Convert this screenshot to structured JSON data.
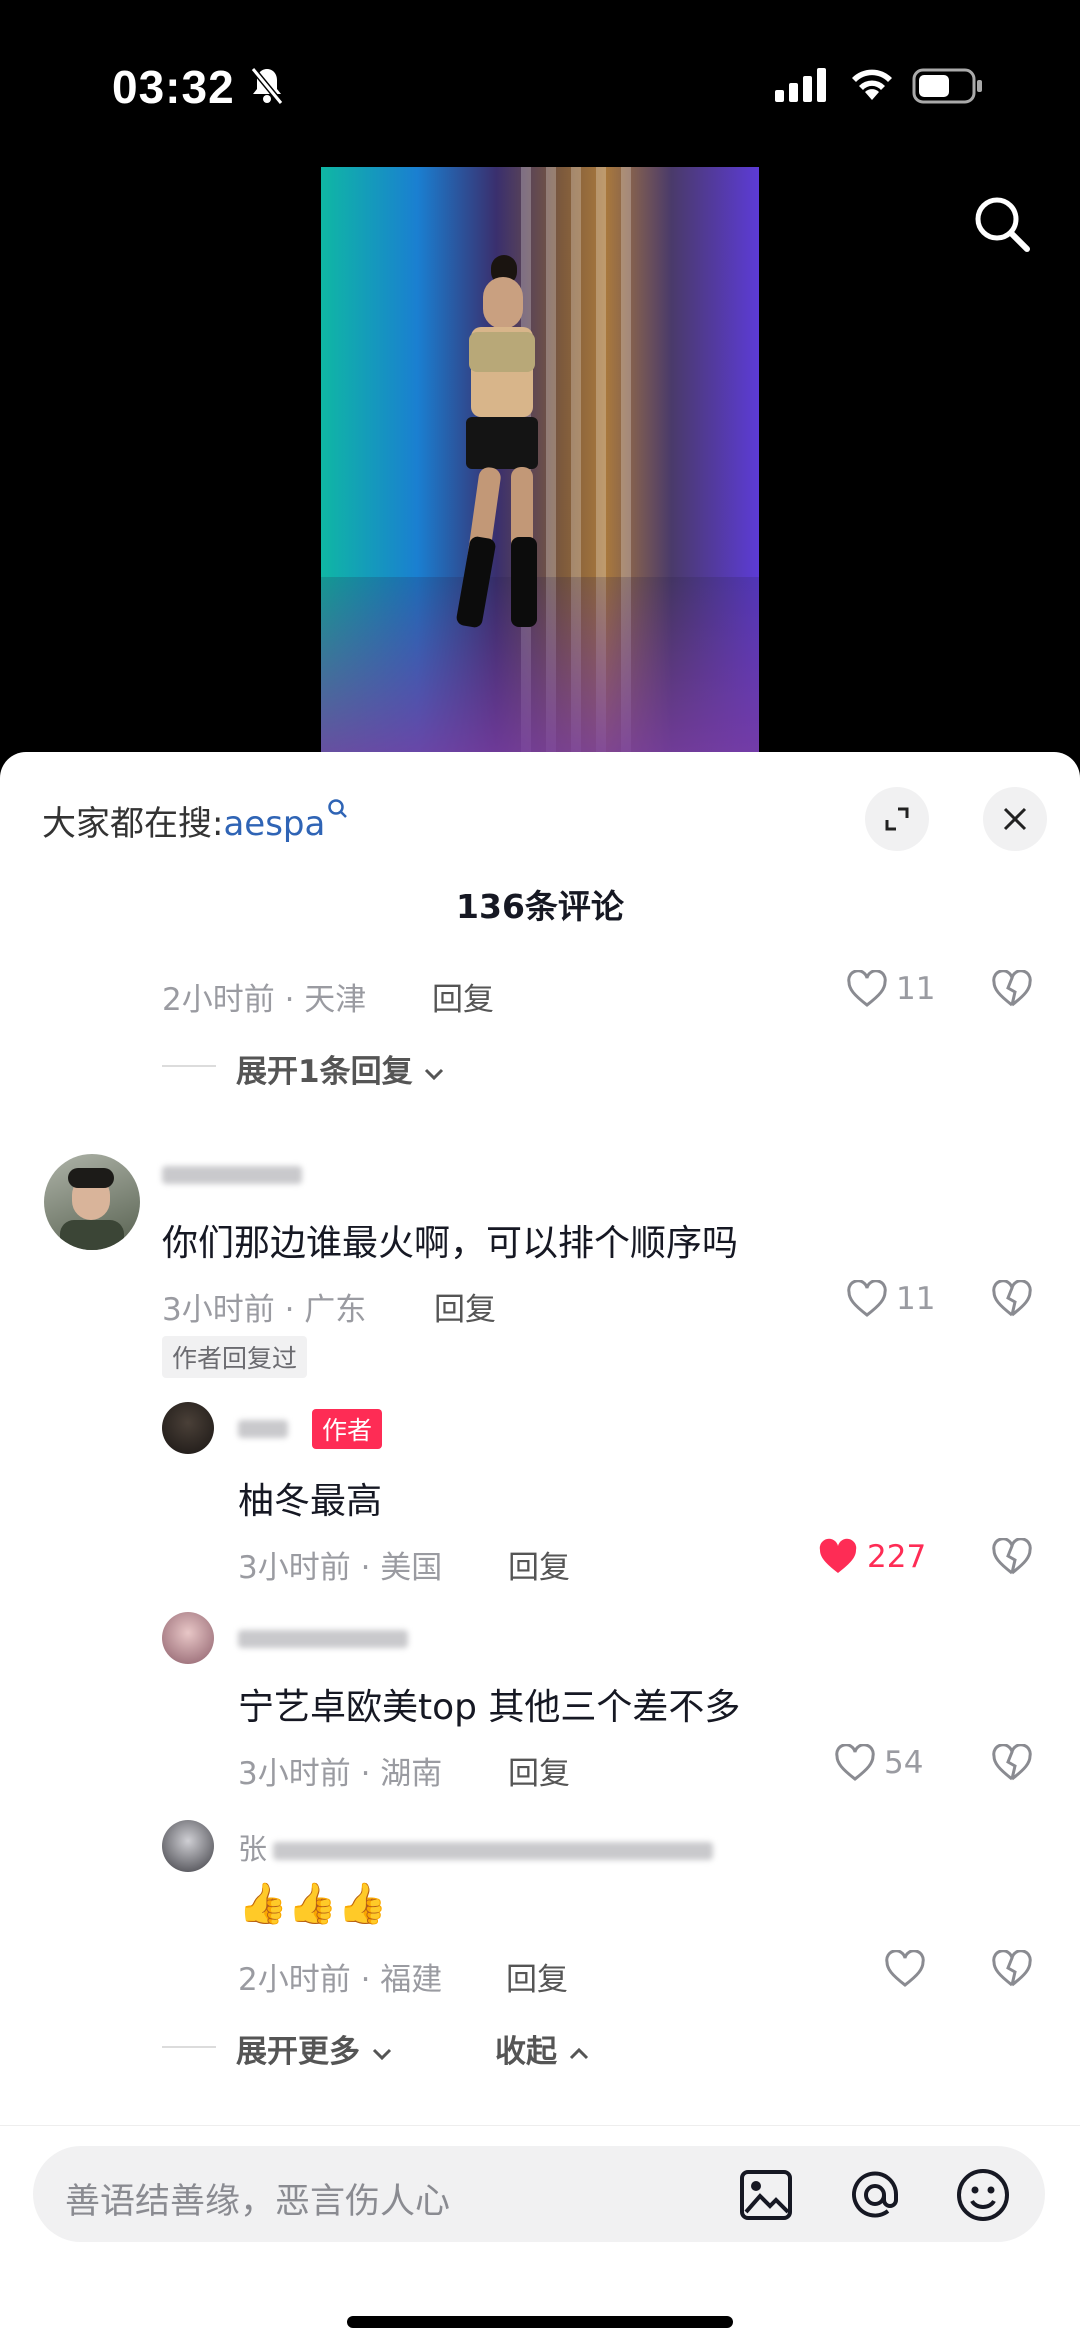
{
  "status_bar": {
    "time": "03:32"
  },
  "search_suggest": {
    "prefix": "大家都在搜:",
    "keyword": "aespa"
  },
  "comment_count": "136条评论",
  "comments": [
    {
      "meta": "2小时前 · 天津",
      "reply": "回复",
      "likes": "11",
      "expand": "展开1条回复"
    },
    {
      "text": "你们那边谁最火啊，可以排个顺序吗",
      "meta": "3小时前 · 广东",
      "reply": "回复",
      "likes": "11",
      "tag": "作者回复过",
      "replies": [
        {
          "badge": "作者",
          "text": "柚冬最高",
          "meta": "3小时前 · 美国",
          "reply": "回复",
          "likes": "227",
          "liked": true
        },
        {
          "text": "宁艺卓欧美top 其他三个差不多",
          "meta": "3小时前 · 湖南",
          "reply": "回复",
          "likes": "54"
        },
        {
          "name_prefix": "张",
          "text": "👍👍👍",
          "meta": "2小时前 · 福建",
          "reply": "回复",
          "likes": ""
        }
      ]
    }
  ],
  "expand_more": "展开更多",
  "collapse": "收起",
  "input_placeholder": "善语结善缘，恶言伤人心",
  "colors": {
    "accent": "#fe2c55",
    "keyword": "#2f64b5"
  }
}
